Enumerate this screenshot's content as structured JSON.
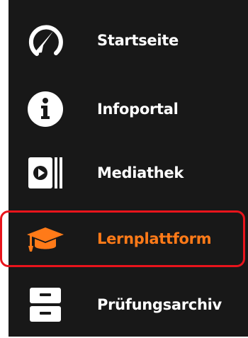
{
  "menu": {
    "items": [
      {
        "label": "Startseite",
        "icon": "dashboard-gauge-icon",
        "active": false
      },
      {
        "label": "Infoportal",
        "icon": "info-icon",
        "active": false
      },
      {
        "label": "Mediathek",
        "icon": "media-library-icon",
        "active": false
      },
      {
        "label": "Lernplattform",
        "icon": "graduation-cap-icon",
        "active": true
      },
      {
        "label": "Prüfungsarchiv",
        "icon": "archive-drawer-icon",
        "active": false
      }
    ]
  },
  "colors": {
    "background": "#181818",
    "text": "#ffffff",
    "active": "#ff7a18",
    "highlight_border": "#e8141c"
  }
}
